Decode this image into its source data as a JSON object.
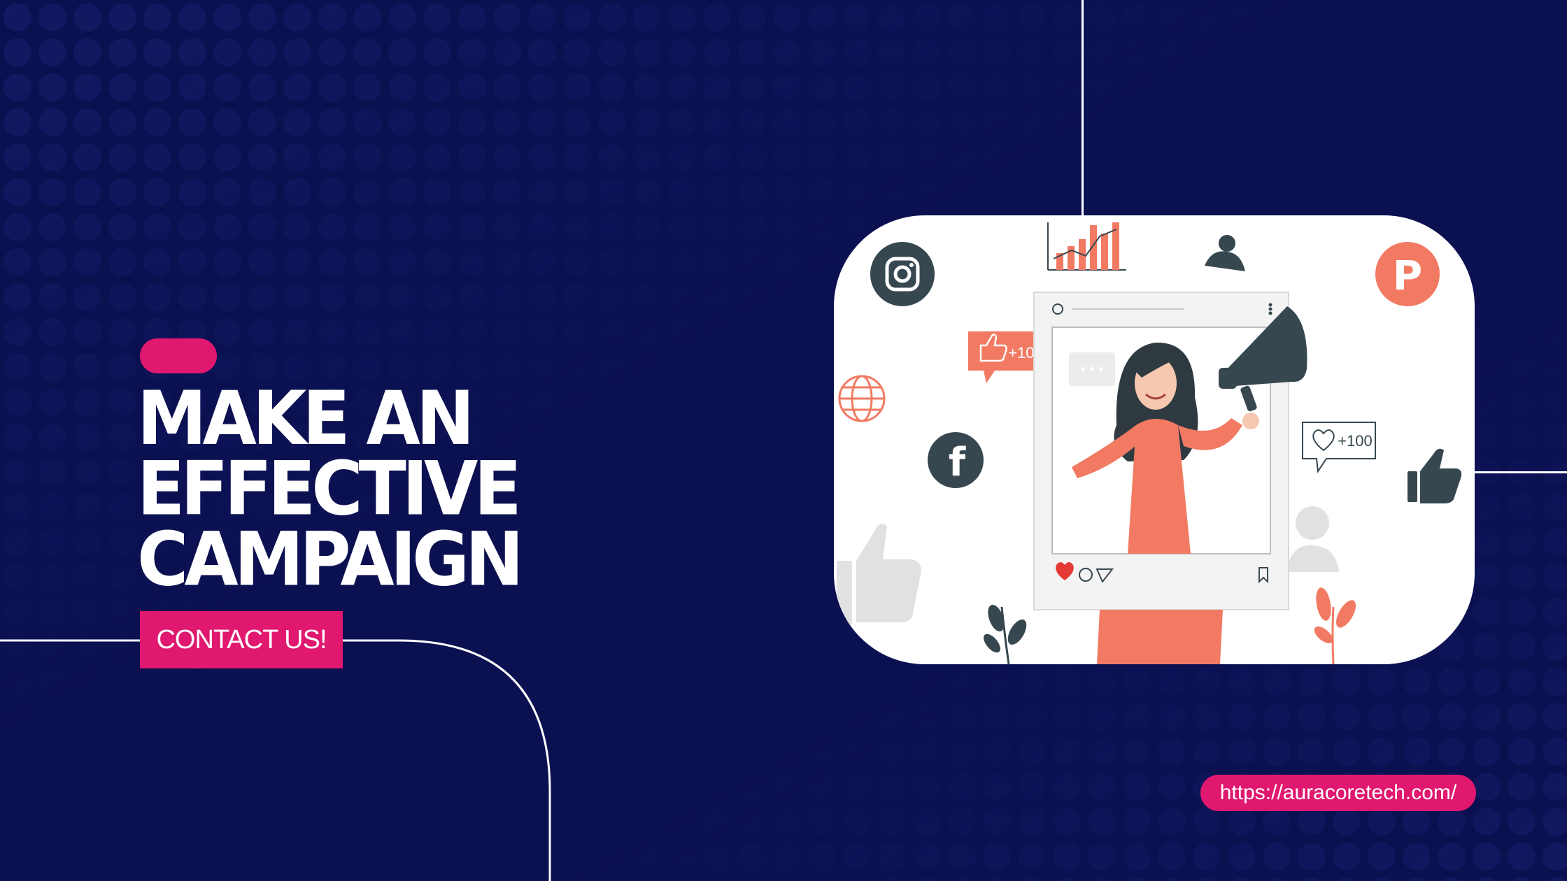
{
  "headline": {
    "line1": "MAKE AN EFFECTIVE",
    "line2": "CAMPAIGN"
  },
  "cta": {
    "label": "CONTACT US!"
  },
  "website": {
    "url": "https://auracoretech.com/"
  },
  "illustration": {
    "likes_badge": "+100",
    "hearts_badge": "+100",
    "icons": [
      "instagram-icon",
      "pinterest-icon",
      "facebook-icon",
      "globe-icon",
      "megaphone-icon",
      "bar-chart-icon",
      "user-icon",
      "thumbs-up-icon",
      "heart-icon",
      "comment-icon",
      "share-icon",
      "bookmark-icon"
    ]
  },
  "colors": {
    "background": "#0b1050",
    "accent": "#e0186f",
    "illustration_coral": "#f27a63",
    "illustration_dark": "#37474f"
  }
}
